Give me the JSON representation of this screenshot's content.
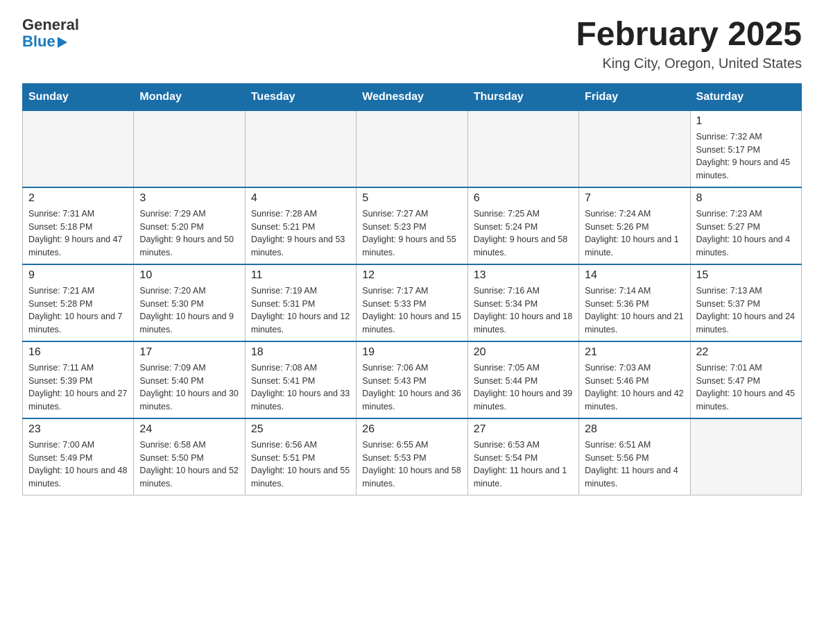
{
  "logo": {
    "text_general": "General",
    "text_blue": "Blue",
    "arrow": "▶"
  },
  "title": "February 2025",
  "subtitle": "King City, Oregon, United States",
  "weekdays": [
    "Sunday",
    "Monday",
    "Tuesday",
    "Wednesday",
    "Thursday",
    "Friday",
    "Saturday"
  ],
  "weeks": [
    [
      {
        "day": "",
        "info": ""
      },
      {
        "day": "",
        "info": ""
      },
      {
        "day": "",
        "info": ""
      },
      {
        "day": "",
        "info": ""
      },
      {
        "day": "",
        "info": ""
      },
      {
        "day": "",
        "info": ""
      },
      {
        "day": "1",
        "info": "Sunrise: 7:32 AM\nSunset: 5:17 PM\nDaylight: 9 hours and 45 minutes."
      }
    ],
    [
      {
        "day": "2",
        "info": "Sunrise: 7:31 AM\nSunset: 5:18 PM\nDaylight: 9 hours and 47 minutes."
      },
      {
        "day": "3",
        "info": "Sunrise: 7:29 AM\nSunset: 5:20 PM\nDaylight: 9 hours and 50 minutes."
      },
      {
        "day": "4",
        "info": "Sunrise: 7:28 AM\nSunset: 5:21 PM\nDaylight: 9 hours and 53 minutes."
      },
      {
        "day": "5",
        "info": "Sunrise: 7:27 AM\nSunset: 5:23 PM\nDaylight: 9 hours and 55 minutes."
      },
      {
        "day": "6",
        "info": "Sunrise: 7:25 AM\nSunset: 5:24 PM\nDaylight: 9 hours and 58 minutes."
      },
      {
        "day": "7",
        "info": "Sunrise: 7:24 AM\nSunset: 5:26 PM\nDaylight: 10 hours and 1 minute."
      },
      {
        "day": "8",
        "info": "Sunrise: 7:23 AM\nSunset: 5:27 PM\nDaylight: 10 hours and 4 minutes."
      }
    ],
    [
      {
        "day": "9",
        "info": "Sunrise: 7:21 AM\nSunset: 5:28 PM\nDaylight: 10 hours and 7 minutes."
      },
      {
        "day": "10",
        "info": "Sunrise: 7:20 AM\nSunset: 5:30 PM\nDaylight: 10 hours and 9 minutes."
      },
      {
        "day": "11",
        "info": "Sunrise: 7:19 AM\nSunset: 5:31 PM\nDaylight: 10 hours and 12 minutes."
      },
      {
        "day": "12",
        "info": "Sunrise: 7:17 AM\nSunset: 5:33 PM\nDaylight: 10 hours and 15 minutes."
      },
      {
        "day": "13",
        "info": "Sunrise: 7:16 AM\nSunset: 5:34 PM\nDaylight: 10 hours and 18 minutes."
      },
      {
        "day": "14",
        "info": "Sunrise: 7:14 AM\nSunset: 5:36 PM\nDaylight: 10 hours and 21 minutes."
      },
      {
        "day": "15",
        "info": "Sunrise: 7:13 AM\nSunset: 5:37 PM\nDaylight: 10 hours and 24 minutes."
      }
    ],
    [
      {
        "day": "16",
        "info": "Sunrise: 7:11 AM\nSunset: 5:39 PM\nDaylight: 10 hours and 27 minutes."
      },
      {
        "day": "17",
        "info": "Sunrise: 7:09 AM\nSunset: 5:40 PM\nDaylight: 10 hours and 30 minutes."
      },
      {
        "day": "18",
        "info": "Sunrise: 7:08 AM\nSunset: 5:41 PM\nDaylight: 10 hours and 33 minutes."
      },
      {
        "day": "19",
        "info": "Sunrise: 7:06 AM\nSunset: 5:43 PM\nDaylight: 10 hours and 36 minutes."
      },
      {
        "day": "20",
        "info": "Sunrise: 7:05 AM\nSunset: 5:44 PM\nDaylight: 10 hours and 39 minutes."
      },
      {
        "day": "21",
        "info": "Sunrise: 7:03 AM\nSunset: 5:46 PM\nDaylight: 10 hours and 42 minutes."
      },
      {
        "day": "22",
        "info": "Sunrise: 7:01 AM\nSunset: 5:47 PM\nDaylight: 10 hours and 45 minutes."
      }
    ],
    [
      {
        "day": "23",
        "info": "Sunrise: 7:00 AM\nSunset: 5:49 PM\nDaylight: 10 hours and 48 minutes."
      },
      {
        "day": "24",
        "info": "Sunrise: 6:58 AM\nSunset: 5:50 PM\nDaylight: 10 hours and 52 minutes."
      },
      {
        "day": "25",
        "info": "Sunrise: 6:56 AM\nSunset: 5:51 PM\nDaylight: 10 hours and 55 minutes."
      },
      {
        "day": "26",
        "info": "Sunrise: 6:55 AM\nSunset: 5:53 PM\nDaylight: 10 hours and 58 minutes."
      },
      {
        "day": "27",
        "info": "Sunrise: 6:53 AM\nSunset: 5:54 PM\nDaylight: 11 hours and 1 minute."
      },
      {
        "day": "28",
        "info": "Sunrise: 6:51 AM\nSunset: 5:56 PM\nDaylight: 11 hours and 4 minutes."
      },
      {
        "day": "",
        "info": ""
      }
    ]
  ]
}
